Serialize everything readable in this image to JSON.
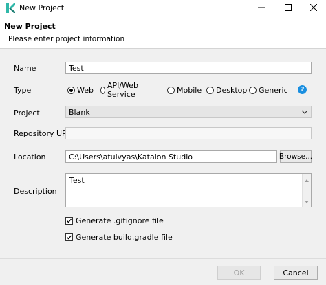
{
  "window": {
    "title": "New Project"
  },
  "header": {
    "title": "New Project",
    "subtitle": "Please enter project information"
  },
  "form": {
    "name_label": "Name",
    "name_value": "Test",
    "type_label": "Type",
    "type_options": [
      "Web",
      "API/Web Service",
      "Mobile",
      "Desktop",
      "Generic"
    ],
    "type_selected": "Web",
    "project_label": "Project",
    "project_value": "Blank",
    "repo_label": "Repository URL",
    "repo_value": "",
    "location_label": "Location",
    "location_value": "C:\\Users\\atulvyas\\Katalon Studio",
    "browse_label": "Browse...",
    "description_label": "Description",
    "description_value": "Test",
    "gitignore_label": "Generate .gitignore file",
    "gitignore_checked": true,
    "gradle_label": "Generate build.gradle file",
    "gradle_checked": true
  },
  "footer": {
    "ok_label": "OK",
    "cancel_label": "Cancel"
  },
  "colors": {
    "accent": "#1a8fe0",
    "header_bg": "#ffffff",
    "content_bg": "#f0f0f0"
  },
  "icons": {
    "app": "katalon-logo-icon",
    "help": "help-icon"
  }
}
